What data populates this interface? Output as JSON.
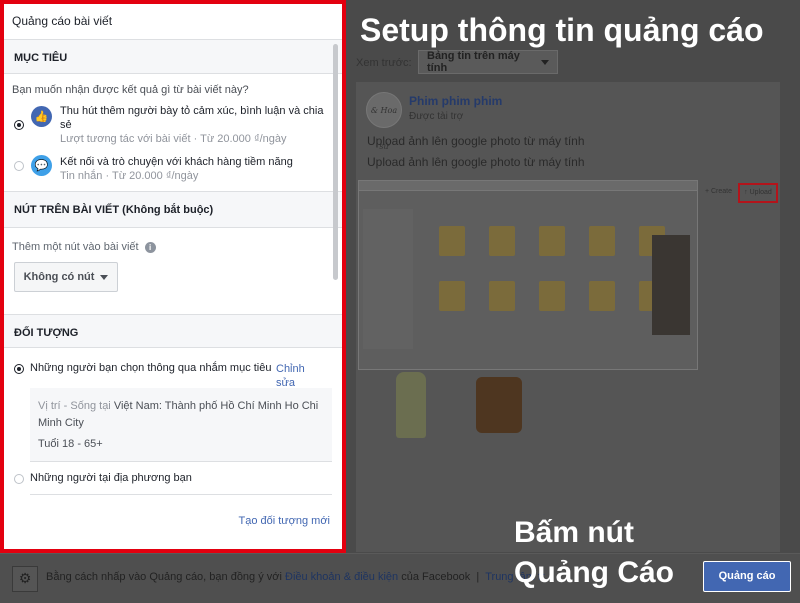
{
  "panel": {
    "title": "Quảng cáo bài viết",
    "objective": {
      "title": "MỤC TIÊU",
      "question": "Bạn muốn nhận được kết quả gì từ bài viết này?",
      "options": [
        {
          "title": "Thu hút thêm người bày tỏ cảm xúc, bình luận và chia sẻ",
          "sub": "Lượt tương tác với bài viết · Từ 20.000 ₫/ngày",
          "selected": true,
          "icon": "thumbs-up-icon",
          "color": "#4267b2"
        },
        {
          "title": "Kết nối và trò chuyện với khách hàng tiềm năng",
          "sub": "Tin nhắn · Từ 20.000 ₫/ngày",
          "selected": false,
          "icon": "messenger-icon",
          "color": "#3ea0e8"
        }
      ]
    },
    "button_section": {
      "title": "NÚT TRÊN BÀI VIẾT (Không bắt buộc)",
      "label": "Thêm một nút vào bài viết",
      "dropdown_value": "Không có nút"
    },
    "audience": {
      "title": "ĐỐI TƯỢNG",
      "option1": "Những người bạn chọn thông qua nhắm mục tiêu",
      "edit_link": "Chỉnh sửa",
      "location_prefix": "Vị trí - Sống tại",
      "location_value": "Việt Nam: Thành phố Hồ Chí Minh Ho Chi Minh City",
      "age": "Tuổi 18 - 65+",
      "option2": "Những người tại địa phương bạn",
      "create_link": "Tạo đối tượng mới"
    }
  },
  "preview": {
    "headline": "Setup thông tin quảng cáo",
    "label": "Xem trước:",
    "select_value": "Bảng tin trên máy tính",
    "page_name": "Phim phim phim",
    "sponsored": "Được tài trợ",
    "avatar_text": "& Hoa sữ",
    "line1": "Upload ảnh lên google photo từ máy tính",
    "line2": "Upload ảnh lên google photo từ máy tính",
    "create": "+ Create",
    "upload": "↑ Upload"
  },
  "footer": {
    "text_prefix": "Bằng cách nhấp vào Quảng cáo, bạn đồng ý với",
    "terms_link": "Điều khoản & điều kiện",
    "text_mid": "của Facebook",
    "help_link": "Trung tâm tr",
    "cta_overlay_line1": "Bấm nút",
    "cta_overlay_line2": "Quảng Cáo",
    "ad_button": "Quảng cáo"
  },
  "colors": {
    "highlight_border": "#e3000f",
    "fb_blue": "#4267b2"
  }
}
